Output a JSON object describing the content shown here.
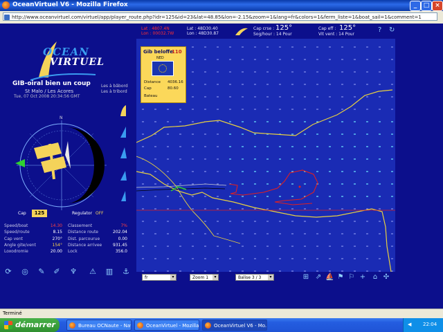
{
  "window": {
    "title": "OceanVirtuel V6 - Mozilla Firefox"
  },
  "address": {
    "url": "http://www.oceanvirtuel.com/virtuel/app/player_route.php?idr=125&id=23&lat=48.85&lon=-2.15&zoom=1&lang=fr&colors=1&ferm_liste=1&boat_sail=1&comment=1"
  },
  "header": {
    "lat_label": "Lat : 4807.4N",
    "lon_label": "Lon : 00032.7W",
    "lat_dd": "Lat : 48D30.40",
    "lon_dd": "Lon : 48D30.87",
    "cap_label": "Cap crse :",
    "cap_value": "125°",
    "speed": "Sog/hour : 14 Pour",
    "cap_eff_label": "Cap eff :",
    "cap_eff_value": "125°",
    "wind_speed": "Vit vent : 14 Pour"
  },
  "logo": {
    "line1": "OCEAN",
    "line2": "VIRTUEL"
  },
  "boat": {
    "name": "GIB-oiral bien un coup",
    "route": "St Malo / Les Acores",
    "date": "Tue, 07 Oct 2008 20:34:56 GMT",
    "side1": "Les à bâbord",
    "side2": "Les à tribord"
  },
  "controls": {
    "cap_label": "Cap",
    "cap_value": "125",
    "regulator_label": "Regulator",
    "regulator_value": "OFF"
  },
  "stats_left": [
    {
      "label": "Speed/boat",
      "value": "14.30",
      "color": "#ff4040"
    },
    {
      "label": "Speed/route",
      "value": "8.15",
      "color": "#ffffff"
    },
    {
      "label": "Cap vent",
      "value": "270°",
      "color": "#ffffff"
    },
    {
      "label": "Angle gite/vent",
      "value": "154°",
      "color": "#ffd84a"
    },
    {
      "label": "Loxodromie",
      "value": "20.00",
      "color": "#ffffff"
    }
  ],
  "stats_right": [
    {
      "label": "Classement",
      "value": "7%",
      "color": "#ff4040"
    },
    {
      "label": "Distance route",
      "value": "202.04",
      "color": "#ffffff"
    },
    {
      "label": "Dist. parcourue",
      "value": "0.00",
      "color": "#ffffff"
    },
    {
      "label": "Distance arrivee",
      "value": "931.45",
      "color": "#ffffff"
    },
    {
      "label": "Lock",
      "value": "356.0",
      "color": "#ffffff"
    }
  ],
  "popup": {
    "title": "Gib beloffe",
    "number": "110",
    "code": "NED",
    "rows": [
      {
        "label": "Distance",
        "value": "4036.16"
      },
      {
        "label": "Cap",
        "value": "80.60"
      }
    ],
    "footer": "Bateau"
  },
  "map_selects": [
    {
      "value": "fr"
    },
    {
      "value": "Zoom 1"
    },
    {
      "value": "Balise 3 / 3"
    }
  ],
  "status": {
    "text": "Terminé"
  },
  "taskbar": {
    "start": "démarrer",
    "tasks": [
      "Bureau OCNaute - Navi...",
      "OceanVirtuel - Mozilla...",
      "OceanVirtuel V6 - Mo..."
    ],
    "clock": "22:04"
  },
  "colors": {
    "background": "#0c0f8c",
    "map": "#1a2bb4",
    "accent_yellow": "#f4d35a",
    "track_red": "#e02020",
    "coast_yellow": "#e8d040"
  }
}
